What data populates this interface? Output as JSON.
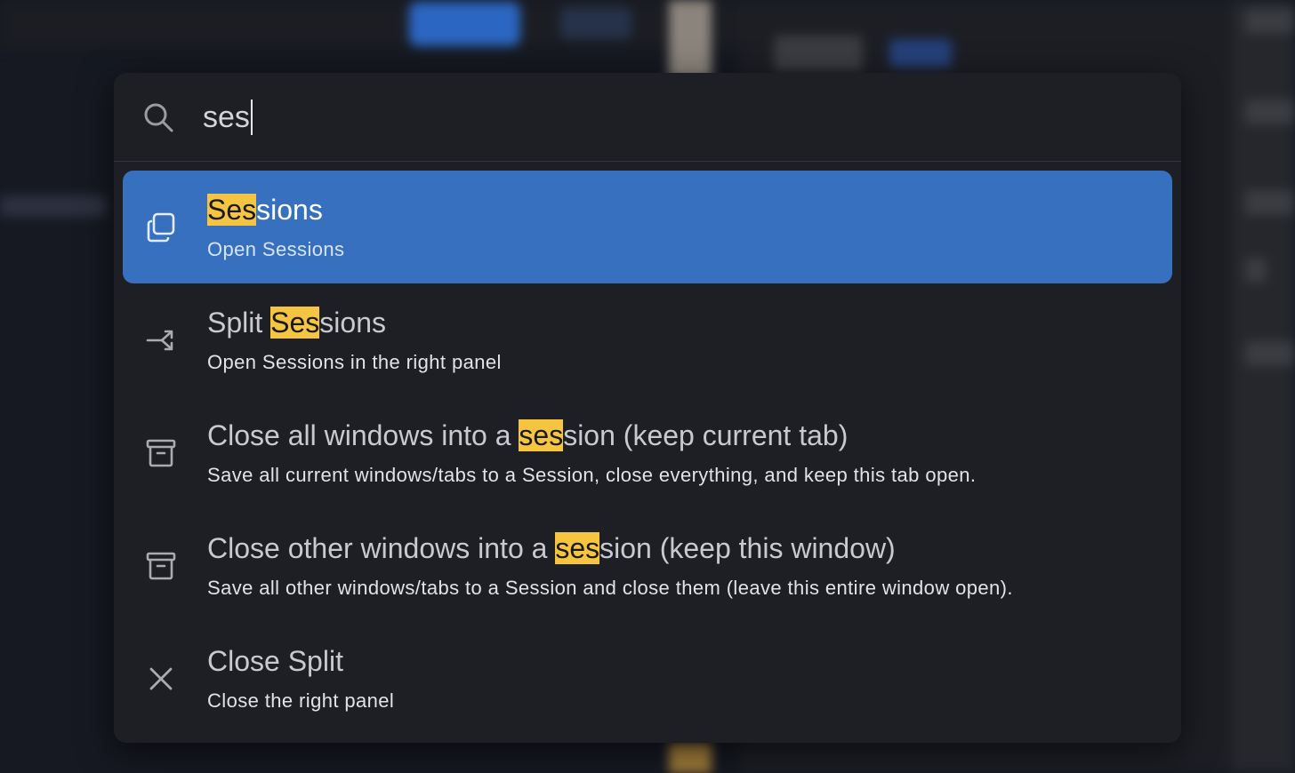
{
  "search": {
    "value": "ses"
  },
  "results": [
    {
      "icon": "copy-icon",
      "title_pre": "",
      "title_match": "Ses",
      "title_post": "sions",
      "subtitle": "Open Sessions",
      "selected": true
    },
    {
      "icon": "split-arrows-icon",
      "title_pre": "Split ",
      "title_match": "Ses",
      "title_post": "sions",
      "subtitle": "Open Sessions in the right panel",
      "selected": false
    },
    {
      "icon": "archive-icon",
      "title_pre": "Close all windows into a ",
      "title_match": "ses",
      "title_post": "sion (keep current tab)",
      "subtitle": "Save all current windows/tabs to a Session, close everything, and keep this tab open.",
      "selected": false
    },
    {
      "icon": "archive-icon",
      "title_pre": "Close other windows into a ",
      "title_match": "ses",
      "title_post": "sion (keep this window)",
      "subtitle": "Save all other windows/tabs to a Session and close them (leave this entire window open).",
      "selected": false
    },
    {
      "icon": "close-icon",
      "title_pre": "Close Split",
      "title_match": "",
      "title_post": "",
      "subtitle": "Close the right panel",
      "selected": false
    }
  ],
  "colors": {
    "selected_bg": "#3870c0",
    "highlight": "#f5c542",
    "palette_bg": "#1d1f24"
  }
}
